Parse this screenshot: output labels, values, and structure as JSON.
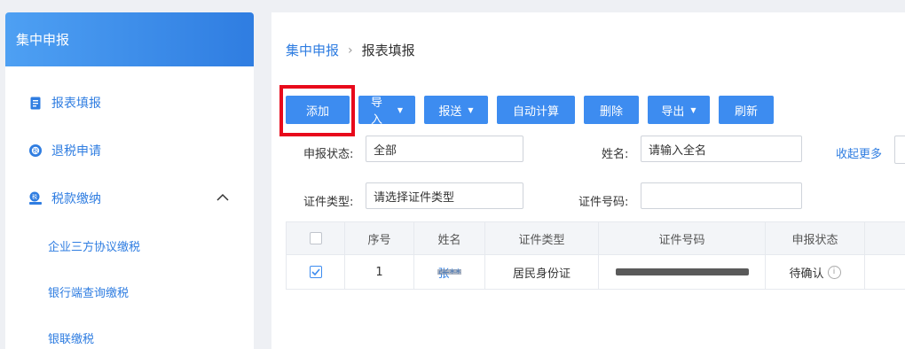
{
  "sidebar": {
    "title": "集中申报",
    "items": [
      {
        "label": "报表填报",
        "icon": "document-icon"
      },
      {
        "label": "退税申请",
        "icon": "tax-refund-icon"
      },
      {
        "label": "税款缴纳",
        "icon": "tax-payment-icon",
        "expanded": true
      }
    ],
    "subitems": [
      {
        "label": "企业三方协议缴税"
      },
      {
        "label": "银行端查询缴税"
      },
      {
        "label": "银联缴税"
      }
    ]
  },
  "breadcrumb": {
    "parent": "集中申报",
    "separator": "›",
    "current": "报表填报"
  },
  "toolbar": {
    "add": "添加",
    "import": "导入",
    "send": "报送",
    "auto_calc": "自动计算",
    "delete": "删除",
    "export": "导出",
    "refresh": "刷新"
  },
  "filters": {
    "status_label": "申报状态:",
    "status_value": "全部",
    "name_label": "姓名:",
    "name_placeholder": "请输入全名",
    "id_type_label": "证件类型:",
    "id_type_placeholder": "请选择证件类型",
    "id_number_label": "证件号码:",
    "id_number_value": "",
    "collapse": "收起更多"
  },
  "table": {
    "headers": [
      "序号",
      "姓名",
      "证件类型",
      "证件号码",
      "申报状态"
    ],
    "rows": [
      {
        "checked": true,
        "index": "1",
        "name": "张**",
        "id_type": "居民身份证",
        "id_number": "",
        "status": "待确认"
      }
    ]
  },
  "colors": {
    "accent": "#3d8cf0",
    "highlight": "#e8091b"
  }
}
